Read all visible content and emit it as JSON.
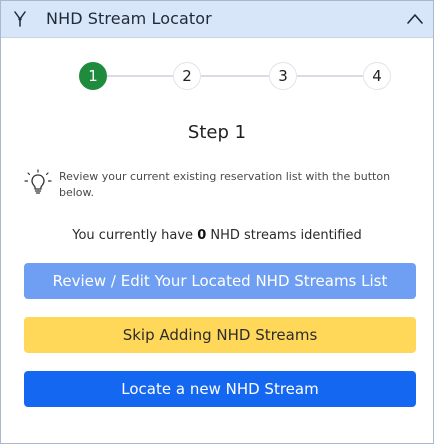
{
  "header": {
    "title": "NHD Stream Locator",
    "icon": "fork-icon",
    "collapse_icon": "chevron-up-icon"
  },
  "stepper": {
    "steps": [
      "1",
      "2",
      "3",
      "4"
    ],
    "active_index": 0,
    "active_color": "#1e8c3c"
  },
  "step": {
    "title": "Step 1",
    "hint_icon": "lightbulb-icon",
    "hint": "Review your current existing reservation list with the button below."
  },
  "count": {
    "prefix": "You currently have",
    "value": "0",
    "suffix": "NHD streams identified"
  },
  "buttons": {
    "review": "Review / Edit Your Located NHD Streams List",
    "skip": "Skip Adding NHD Streams",
    "locate": "Locate a new NHD Stream"
  },
  "colors": {
    "header_bg": "#d7e6f8",
    "review_bg": "#6f9ff2",
    "skip_bg": "#ffd85a",
    "locate_bg": "#1467f0"
  }
}
